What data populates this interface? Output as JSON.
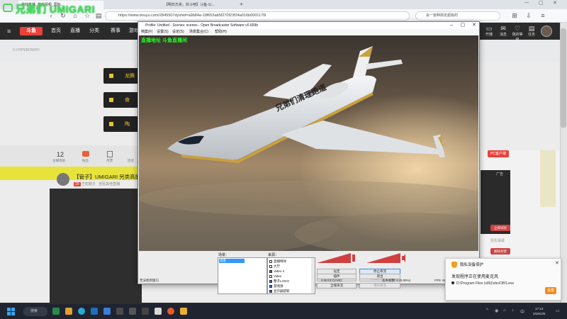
{
  "watermark": {
    "text": "兄弟们 UMIGARI"
  },
  "browser": {
    "tabs": [
      {
        "label": "游戏直播_游戏视频_国际..."
      },
      {
        "label": "【明日方舟，抖斗吧】斗鱼·公..."
      },
      {
        "label": "UMIGARI"
      }
    ],
    "url": "https://www.douyu.com/2845507dyshid=a9b84a-18f653ab5f270f23f24a016b0001170l",
    "search_placeholder": "会一窗种搞定超级的"
  },
  "site": {
    "nav": [
      "首页",
      "直播",
      "分类",
      "赛事",
      "游戏"
    ],
    "header_icons": [
      {
        "glyph": "▭",
        "label": "开播"
      },
      {
        "glyph": "✉",
        "label": "消息"
      },
      {
        "glyph": "♡",
        "label": "我的等级"
      },
      {
        "glyph": "▤",
        "label": "任务"
      }
    ],
    "hero_caption": "© HYPEBOWPH",
    "promo_cards": [
      "龙腾",
      "奋",
      "陶"
    ],
    "stats": [
      {
        "value": "12",
        "label": "主播等级"
      },
      {
        "value": "",
        "label": "粉丝"
      },
      {
        "value": "",
        "label": "月票"
      },
      {
        "value": "",
        "label": "连续"
      }
    ],
    "stream_title": "【管子】UMIGARI 另类高能",
    "streamer_name": "王蛇鳝子",
    "streamer_meta": "吉民其他直播",
    "pc_badge": "PC客户端",
    "ad_label": "广告",
    "ad_button": "立即试玩",
    "bottom_link": "轻松弹幕",
    "bottom_button": "解除封禁"
  },
  "obs": {
    "title": "Profile: Untitled - Scenes: scenes - Open Broadcaster Software v0.659b",
    "menu": [
      "档案(F)",
      "设置(S)",
      "设定(S)",
      "场景集合(C)",
      "帮助(H)"
    ],
    "green_overlay": "直播地址 斗鱼直播间",
    "banner_text": "兄弟们清理跑道",
    "scenes_label": "场景：",
    "sources_label": "来源：",
    "scenes": [
      "场景"
    ],
    "sources": [
      {
        "label": "直播特效",
        "checked": false
      },
      {
        "label": "大厅",
        "checked": false
      },
      {
        "label": "Video 2",
        "checked": true
      },
      {
        "label": "Video",
        "checked": false
      },
      {
        "label": "整子LOGO",
        "checked": true
      },
      {
        "label": "游戏源",
        "checked": true
      },
      {
        "label": "显示器获取",
        "checked": true
      }
    ],
    "buttons": {
      "settings": "设定",
      "stop_stream": "停止串流",
      "edit_scene": "编辑场景",
      "start_record": "开始录制",
      "fullscreen": "全域串流",
      "preview_stream": "预览串流",
      "plugins": "插件",
      "exit": "退出"
    },
    "status_left": "无法找到窗口",
    "status_time": "0:00:01 (LIVE)",
    "status_dropped": "丢失帧数: 0 (0.00%)",
    "status_fps": "FPS: 60",
    "status_kbps": "2700kb/s"
  },
  "notification": {
    "title": "隐私设备保护",
    "body": "发现程序正在使用麦克风",
    "path": "D:\\Program Files (x86)\\obs\\OBS.exe",
    "button": "设置"
  },
  "taskbar": {
    "search": "搜索",
    "time": "17:13",
    "date": "2026/2/6"
  }
}
